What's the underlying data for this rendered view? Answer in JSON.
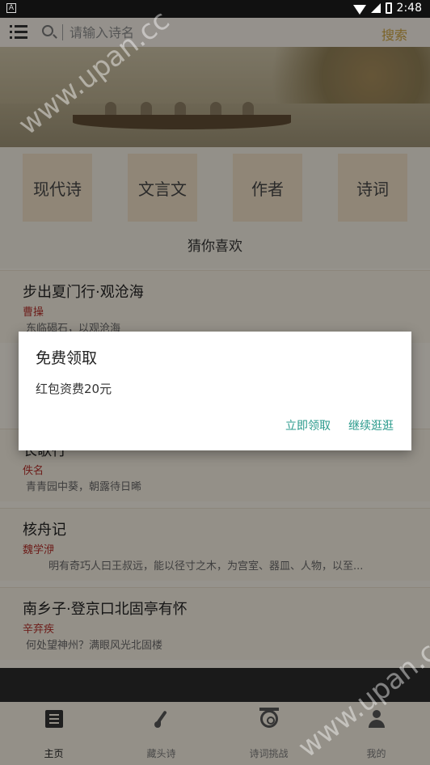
{
  "status_bar": {
    "time": "2:48",
    "badge": "A"
  },
  "header": {
    "search_placeholder": "请输入诗名",
    "search_button": "搜索"
  },
  "categories": [
    "现代诗",
    "文言文",
    "作者",
    "诗词"
  ],
  "guess_title": "猜你喜欢",
  "poems": [
    {
      "title": "步出夏门行·观沧海",
      "author": "曹操",
      "line": "东临碣石，以观沧海"
    },
    {
      "title": "长歌行",
      "author": "佚名",
      "line": "青青园中葵，朝露待日晞"
    },
    {
      "title": "核舟记",
      "author": "魏学洢",
      "line": "明有奇巧人曰王叔远，能以径寸之木，为宫室、器皿、人物，以至..."
    },
    {
      "title": "南乡子·登京口北固亭有怀",
      "author": "辛弃疾",
      "line": "何处望神州？满眼风光北固楼"
    }
  ],
  "dialog": {
    "title": "免费领取",
    "message": "红包资费20元",
    "confirm": "立即领取",
    "cancel": "继续逛逛"
  },
  "tabs": [
    {
      "label": "主页",
      "icon": "book-icon",
      "active": true
    },
    {
      "label": "藏头诗",
      "icon": "brush-icon",
      "active": false
    },
    {
      "label": "诗词挑战",
      "icon": "target-icon",
      "active": false
    },
    {
      "label": "我的",
      "icon": "person-icon",
      "active": false
    }
  ],
  "watermarks": [
    "www.upan.cc",
    "www.upan.cc"
  ],
  "colors": {
    "accent": "#2a9a8c",
    "author": "#b0302a",
    "search": "#c8a040"
  }
}
